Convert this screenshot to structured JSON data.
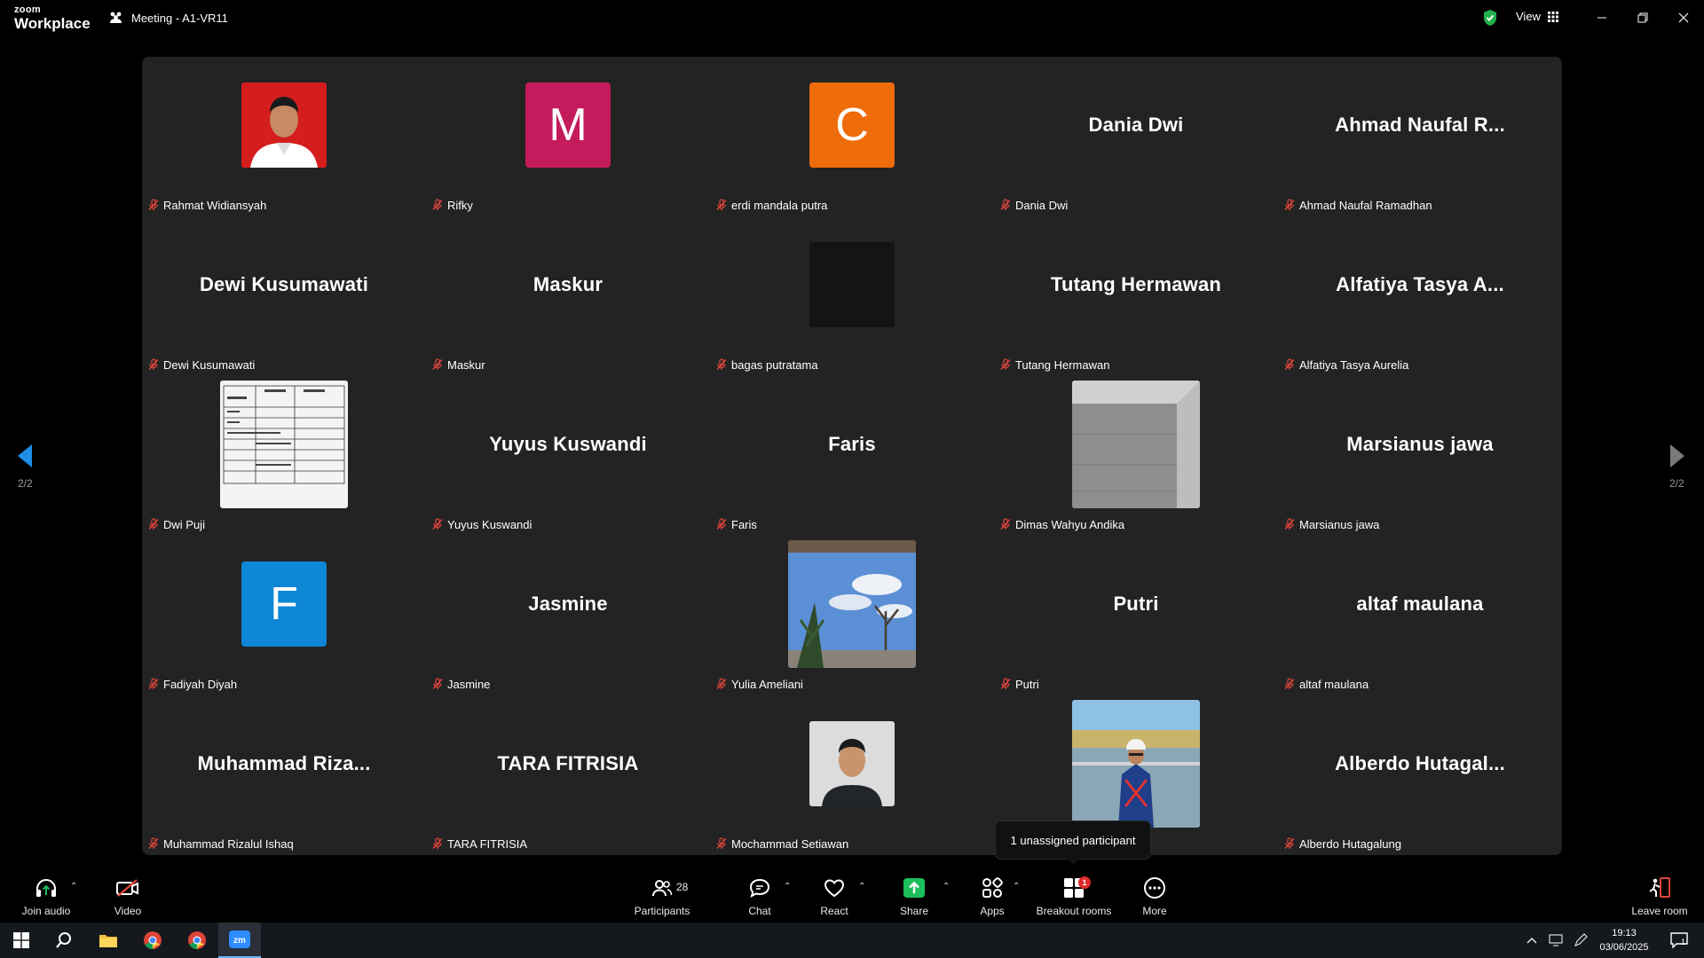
{
  "app": {
    "logo_line1": "zoom",
    "logo_line2": "Workplace",
    "meeting_title": "Meeting - A1-VR11",
    "view_label": "View"
  },
  "colors": {
    "accent_blue": "#1d8fe8",
    "share_green": "#1dbf5a",
    "mute_red": "#e0463c"
  },
  "pager": {
    "left_indicator": "2/2",
    "right_indicator": "2/2"
  },
  "participants": [
    {
      "name": "Rahmat Widiansyah",
      "tile": "photo-red",
      "big_label": ""
    },
    {
      "name": "Rifky",
      "tile": "avatar",
      "initial": "M",
      "avatar_color": "#c41b5c",
      "big_label": ""
    },
    {
      "name": "erdi mandala putra",
      "tile": "avatar",
      "initial": "C",
      "avatar_color": "#ef6c0b",
      "big_label": ""
    },
    {
      "name": "Dania Dwi",
      "tile": "text",
      "big_label": "Dania Dwi"
    },
    {
      "name": "Ahmad Naufal Ramadhan",
      "tile": "text",
      "big_label": "Ahmad  Naufal  R..."
    },
    {
      "name": "Dewi Kusumawati",
      "tile": "text",
      "big_label": "Dewi Kusumawati"
    },
    {
      "name": "Maskur",
      "tile": "text",
      "big_label": "Maskur"
    },
    {
      "name": "bagas putratama",
      "tile": "photo-dark",
      "big_label": ""
    },
    {
      "name": "Tutang Hermawan",
      "tile": "text",
      "big_label": "Tutang Hermawan"
    },
    {
      "name": "Alfatiya Tasya Aurelia",
      "tile": "text",
      "big_label": "Alfatiya Tasya A..."
    },
    {
      "name": "Dwi Puji",
      "tile": "photo-doc",
      "big_label": ""
    },
    {
      "name": "Yuyus Kuswandi",
      "tile": "text",
      "big_label": "Yuyus Kuswandi"
    },
    {
      "name": "Faris",
      "tile": "text",
      "big_label": "Faris"
    },
    {
      "name": "Dimas Wahyu Andika",
      "tile": "photo-room",
      "big_label": ""
    },
    {
      "name": "Marsianus jawa",
      "tile": "text",
      "big_label": "Marsianus jawa"
    },
    {
      "name": "Fadiyah Diyah",
      "tile": "avatar",
      "initial": "F",
      "avatar_color": "#0e87d6",
      "big_label": ""
    },
    {
      "name": "Jasmine",
      "tile": "text",
      "big_label": "Jasmine"
    },
    {
      "name": "Yulia Ameliani",
      "tile": "photo-sky",
      "big_label": ""
    },
    {
      "name": "Putri",
      "tile": "text",
      "big_label": "Putri"
    },
    {
      "name": "altaf maulana",
      "tile": "text",
      "big_label": "altaf maulana"
    },
    {
      "name": "Muhammad Rizalul Ishaq",
      "tile": "text",
      "big_label": "Muhammad  Riza..."
    },
    {
      "name": "TARA FITRISIA",
      "tile": "text",
      "big_label": "TARA FITRISIA"
    },
    {
      "name": "Mochammad Setiawan",
      "tile": "photo-man",
      "big_label": ""
    },
    {
      "name": "",
      "tile": "photo-worker",
      "big_label": ""
    },
    {
      "name": "Alberdo Hutagalung",
      "tile": "text",
      "big_label": "Alberdo  Hutagal..."
    }
  ],
  "tooltip": "1 unassigned participant",
  "toolbar": {
    "join_audio": "Join audio",
    "video": "Video",
    "participants": "Participants",
    "participants_count": "28",
    "chat": "Chat",
    "react": "React",
    "share": "Share",
    "apps": "Apps",
    "breakout_rooms": "Breakout rooms",
    "breakout_badge": "1",
    "more": "More",
    "leave_room": "Leave room"
  },
  "taskbar": {
    "time": "19:13",
    "date": "03/06/2025",
    "notification_count": "1"
  }
}
